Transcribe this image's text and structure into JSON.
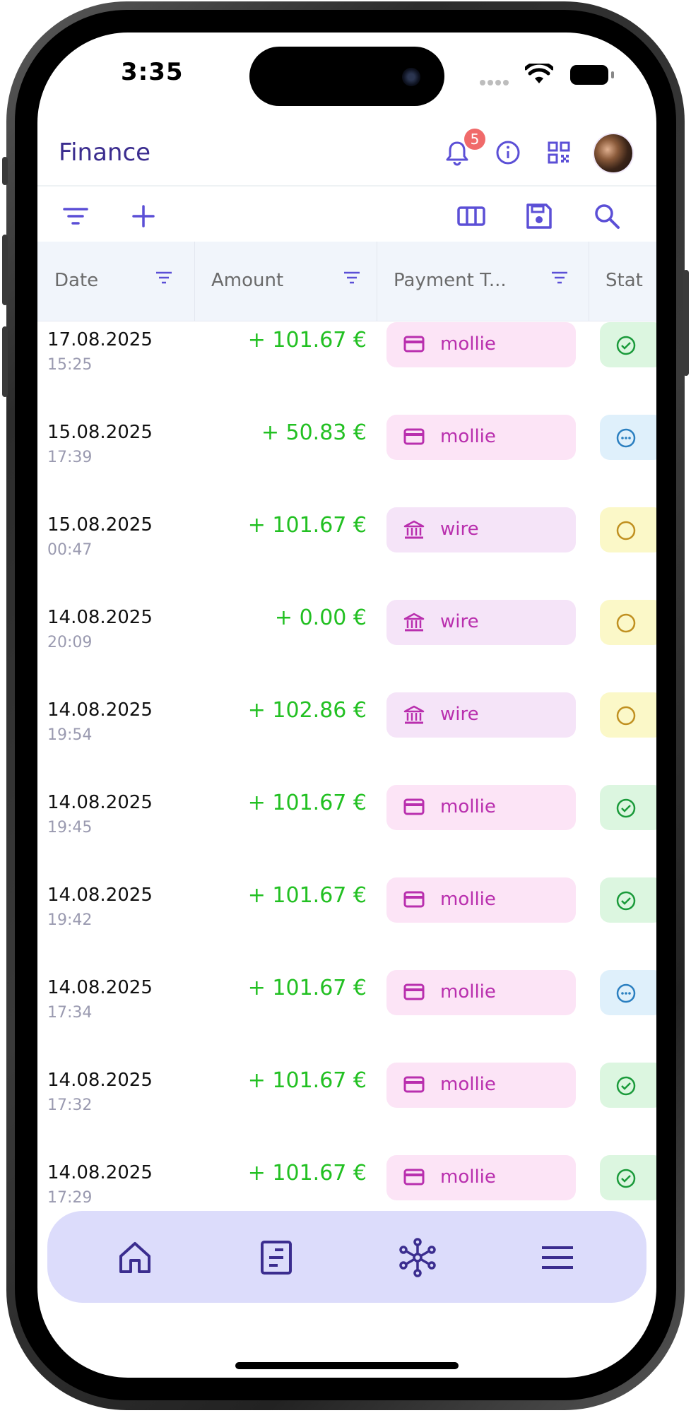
{
  "status_bar": {
    "time": "3:35"
  },
  "header": {
    "title": "Finance",
    "notification_count": "5",
    "icons": [
      "bell-icon",
      "info-icon",
      "qr-code-icon",
      "avatar"
    ]
  },
  "toolbar": {
    "icons": [
      "filter-icon",
      "add-icon",
      "columns-icon",
      "save-icon",
      "search-icon"
    ]
  },
  "table": {
    "columns": [
      "Date",
      "Amount",
      "Payment T...",
      "Stat"
    ],
    "rows": [
      {
        "date": "17.08.2025",
        "time": "15:25",
        "amount": "+ 101.67 €",
        "payment": "mollie",
        "payment_icon": "credit-card-icon",
        "status": "done"
      },
      {
        "date": "15.08.2025",
        "time": "17:39",
        "amount": "+ 50.83 €",
        "payment": "mollie",
        "payment_icon": "credit-card-icon",
        "status": "pending"
      },
      {
        "date": "15.08.2025",
        "time": "00:47",
        "amount": "+ 101.67 €",
        "payment": "wire",
        "payment_icon": "bank-icon",
        "status": "open"
      },
      {
        "date": "14.08.2025",
        "time": "20:09",
        "amount": "+ 0.00 €",
        "payment": "wire",
        "payment_icon": "bank-icon",
        "status": "open"
      },
      {
        "date": "14.08.2025",
        "time": "19:54",
        "amount": "+ 102.86 €",
        "payment": "wire",
        "payment_icon": "bank-icon",
        "status": "open"
      },
      {
        "date": "14.08.2025",
        "time": "19:45",
        "amount": "+ 101.67 €",
        "payment": "mollie",
        "payment_icon": "credit-card-icon",
        "status": "done"
      },
      {
        "date": "14.08.2025",
        "time": "19:42",
        "amount": "+ 101.67 €",
        "payment": "mollie",
        "payment_icon": "credit-card-icon",
        "status": "done"
      },
      {
        "date": "14.08.2025",
        "time": "17:34",
        "amount": "+ 101.67 €",
        "payment": "mollie",
        "payment_icon": "credit-card-icon",
        "status": "pending"
      },
      {
        "date": "14.08.2025",
        "time": "17:32",
        "amount": "+ 101.67 €",
        "payment": "mollie",
        "payment_icon": "credit-card-icon",
        "status": "done"
      },
      {
        "date": "14.08.2025",
        "time": "17:29",
        "amount": "+ 101.67 €",
        "payment": "mollie",
        "payment_icon": "credit-card-icon",
        "status": "done"
      }
    ]
  },
  "bottom_nav": {
    "icons": [
      "home-icon",
      "orders-icon",
      "network-icon",
      "menu-icon"
    ]
  },
  "colors": {
    "primary": "#5b4fd6",
    "title": "#3b2d8f",
    "amount_positive": "#22c022",
    "mollie_bg": "#fce4f6",
    "wire_bg": "#f5e4f8",
    "payment_text": "#b92fae",
    "status_done": "#1a9a3a",
    "status_pending": "#2a7fc0",
    "status_open": "#c09020",
    "nav_bg": "#dcdcfb"
  }
}
